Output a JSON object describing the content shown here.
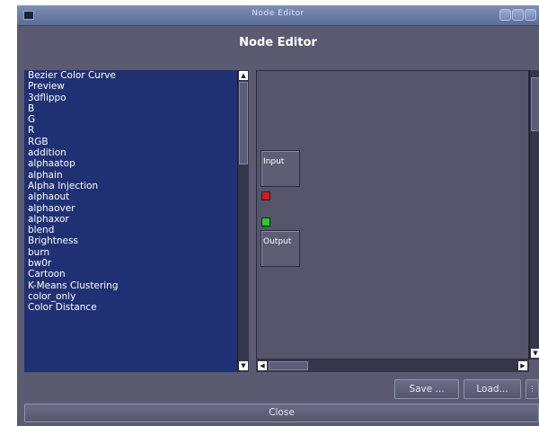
{
  "window": {
    "title": "Node Editor"
  },
  "heading": "Node Editor",
  "effects_list": {
    "items": [
      "Bezier Color Curve",
      "Preview",
      "3dflippo",
      "B",
      "G",
      "R",
      "RGB",
      "addition",
      "alphaatop",
      "alphain",
      "Alpha Injection",
      "alphaout",
      "alphaover",
      "alphaxor",
      "blend",
      "Brightness",
      "burn",
      "bw0r",
      "Cartoon",
      "K-Means Clustering",
      "color_only",
      "Color Distance"
    ]
  },
  "nodes": {
    "input": {
      "label": "Input",
      "output_socket_color": "#e0141e"
    },
    "output": {
      "label": "Output",
      "input_socket_color": "#1ed21e"
    }
  },
  "buttons": {
    "save": "Save ...",
    "load": "Load...",
    "close": "Close"
  },
  "icons": {
    "system_menu": "window-menu-icon",
    "minimize": "minimize-icon",
    "maximize": "maximize-icon",
    "close": "close-icon",
    "scroll_up": "arrow-up-icon",
    "scroll_down": "arrow-down-icon",
    "scroll_left": "arrow-left-icon",
    "scroll_right": "arrow-right-icon"
  },
  "colors": {
    "list_background": "#1f3173",
    "window_background": "#5a5b70",
    "titlebar": "#6b7ea8"
  }
}
